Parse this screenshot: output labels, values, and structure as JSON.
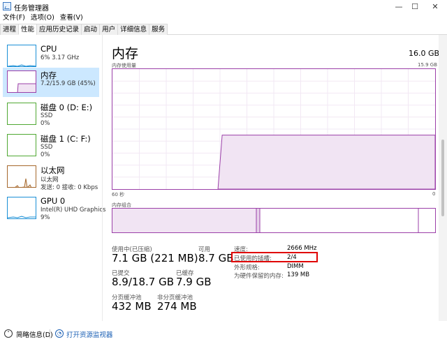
{
  "window": {
    "title": "任务管理器",
    "minimize_glyph": "—",
    "maximize_glyph": "☐",
    "close_glyph": "✕"
  },
  "menu": [
    "文件(F)",
    "选项(O)",
    "查看(V)"
  ],
  "tabs": [
    "进程",
    "性能",
    "应用历史记录",
    "启动",
    "用户",
    "详细信息",
    "服务"
  ],
  "sidebar": {
    "items": [
      {
        "name": "CPU",
        "sub1": "6%  3.17 GHz",
        "sub2": "",
        "color": "#1a8fd6"
      },
      {
        "name": "内存",
        "sub1": "7.2/15.9 GB (45%)",
        "sub2": "",
        "color": "#9b3fa8"
      },
      {
        "name": "磁盘 0 (D: E:)",
        "sub1": "SSD",
        "sub2": "0%",
        "color": "#4fa832"
      },
      {
        "name": "磁盘 1 (C: F:)",
        "sub1": "SSD",
        "sub2": "0%",
        "color": "#4fa832"
      },
      {
        "name": "以太网",
        "sub1": "以太网",
        "sub2": "发送: 0 接收: 0 Kbps",
        "color": "#a5672b"
      },
      {
        "name": "GPU 0",
        "sub1": "Intel(R) UHD Graphics",
        "sub2": "9%",
        "color": "#1a8fd6"
      }
    ]
  },
  "main": {
    "title": "内存",
    "total": "16.0 GB",
    "usage_label": "内存使用量",
    "usage_max": "15.9 GB",
    "time_left": "60 秒",
    "time_right": "0",
    "composition_label": "内存组合",
    "usage_chart": {
      "before_fraction": 0.0,
      "after_fraction": 0.45,
      "step_at": 0.34
    },
    "stats": {
      "in_use_label": "使用中(已压缩)",
      "in_use_value": "7.1 GB (221 MB)",
      "available_label": "可用",
      "available_value": "8.7 GB",
      "committed_label": "已提交",
      "committed_value": "8.9/18.7 GB",
      "cached_label": "已缓存",
      "cached_value": "7.9 GB",
      "paged_label": "分页缓冲池",
      "paged_value": "432 MB",
      "nonpaged_label": "非分页缓冲池",
      "nonpaged_value": "274 MB"
    },
    "details": [
      {
        "label": "速度:",
        "value": "2666 MHz"
      },
      {
        "label": "已使用的插槽:",
        "value": "2/4"
      },
      {
        "label": "外形规格:",
        "value": "DIMM"
      },
      {
        "label": "为硬件保留的内存:",
        "value": "139 MB"
      }
    ]
  },
  "footer": {
    "brief_label": "简略信息(D)",
    "resmon_label": "打开资源监视器"
  }
}
